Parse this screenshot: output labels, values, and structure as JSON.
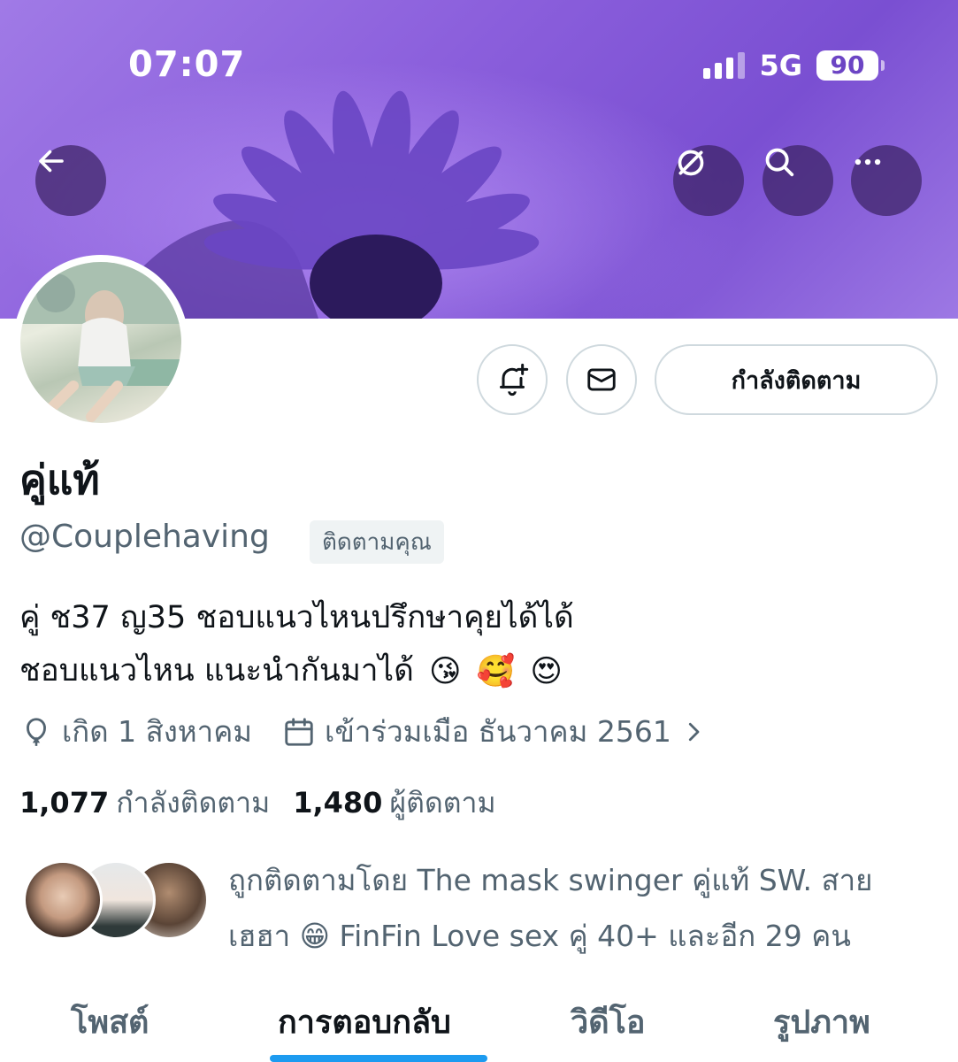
{
  "status_bar": {
    "time": "07:07",
    "network": "5G",
    "battery": "90"
  },
  "colors": {
    "banner": "#8b5fdc",
    "accent": "#1d9bf0",
    "text_primary": "#0f1419",
    "text_secondary": "#536471"
  },
  "header": {
    "back_icon": "arrow-left-icon",
    "icons": [
      "grok-icon",
      "search-icon",
      "more-icon"
    ]
  },
  "profile": {
    "display_name": "คู่แท้",
    "handle": "@Couplehaving",
    "follows_you_badge": "ติดตามคุณ",
    "following_button": "กำลังติดตาม",
    "bio_line1": "คู่ ช37 ญ35 ชอบแนวไหนปรึกษาคุยได้ได้",
    "bio_line2": "ชอบแนวไหน แนะนำกันมาได้",
    "bio_emojis": [
      "😘",
      "🥰",
      "😍"
    ],
    "birthday": "เกิด 1 สิงหาคม",
    "joined": "เข้าร่วมเมือ ธันวาคม 2561"
  },
  "stats": {
    "following_count": "1,077",
    "following_label": "กำลังติดตาม",
    "followers_count": "1,480",
    "followers_label": "ผู้ติดตาม"
  },
  "followed_by": {
    "line1": "ถูกติดตามโดย The mask swinger คู่แท้ SW. สาย",
    "line2_a": "เฮฮา",
    "emoji": "😁",
    "line2_b": "FinFin Love sex คู่ 40+ และอีก 29 คน"
  },
  "tabs": [
    {
      "label": "โพสต์",
      "active": false
    },
    {
      "label": "การตอบกลับ",
      "active": true
    },
    {
      "label": "วิดีโอ",
      "active": false
    },
    {
      "label": "รูปภาพ",
      "active": false
    }
  ]
}
